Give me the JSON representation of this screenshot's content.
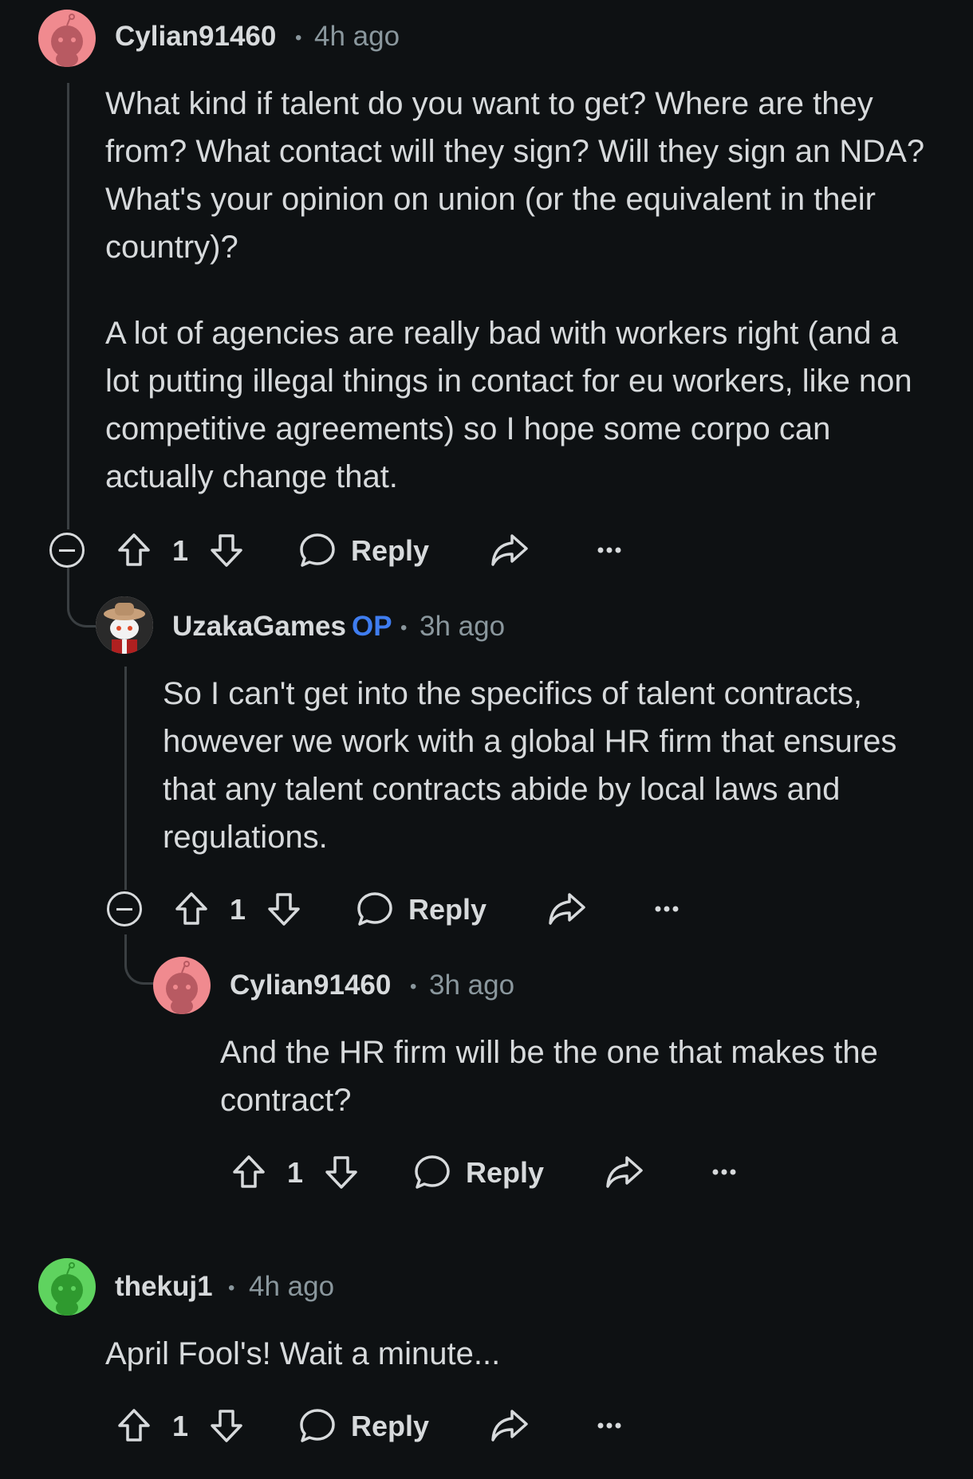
{
  "comments": [
    {
      "username": "Cylian91460",
      "separator": "•",
      "time": "4h ago",
      "paragraphs": [
        "What kind if talent do you want to get? Where are they from? What contact will they sign? Will they sign an NDA? What's your opinion on union (or the equivalent in their country)?",
        "A lot of agencies are really bad with workers right (and a lot putting illegal things in contact for eu workers, like non competitive agreements) so I hope some corpo can actually change that."
      ],
      "votes": "1",
      "reply_label": "Reply",
      "avatar_color": "#f08a8f"
    },
    {
      "username": "UzakaGames",
      "op_badge": "OP",
      "separator": "•",
      "time": "3h ago",
      "paragraphs": [
        "So I can't get into the specifics of talent contracts, however we work with a global HR firm that ensures that any talent contracts abide by local laws and regulations."
      ],
      "votes": "1",
      "reply_label": "Reply",
      "avatar_color": "#e8e8e8"
    },
    {
      "username": "Cylian91460",
      "separator": "•",
      "time": "3h ago",
      "paragraphs": [
        "And the HR firm will be the one that makes the contract?"
      ],
      "votes": "1",
      "reply_label": "Reply",
      "avatar_color": "#f08a8f"
    },
    {
      "username": "thekuj1",
      "separator": "•",
      "time": "4h ago",
      "paragraphs": [
        "April Fool's! Wait a minute..."
      ],
      "votes": "1",
      "reply_label": "Reply",
      "avatar_color": "#5fd35f"
    }
  ],
  "icons": {
    "upvote": "arrow-up-icon",
    "downvote": "arrow-down-icon",
    "reply": "speech-bubble-icon",
    "share": "share-icon",
    "more": "more-dots-icon",
    "collapse": "collapse-icon"
  }
}
